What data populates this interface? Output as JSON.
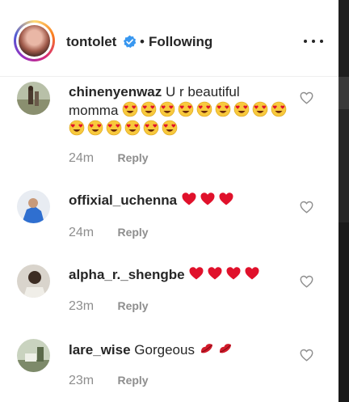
{
  "post": {
    "username": "tontolet",
    "separator": "•",
    "follow_status": "Following"
  },
  "comments": [
    {
      "username": "chinenyenwaz",
      "text": "U r beautiful momma",
      "emoji": "heart-eyes-emoji",
      "emoji_count": 15,
      "time": "24m",
      "reply": "Reply"
    },
    {
      "username": "offixial_uchenna",
      "text": "",
      "emoji": "red-heart-emoji",
      "emoji_count": 3,
      "time": "24m",
      "reply": "Reply"
    },
    {
      "username": "alpha_r._shengbe",
      "text": "",
      "emoji": "red-heart-emoji",
      "emoji_count": 4,
      "time": "23m",
      "reply": "Reply"
    },
    {
      "username": "lare_wise",
      "text": "Gorgeous",
      "emoji": "lips-emoji",
      "emoji_count": 2,
      "time": "23m",
      "reply": "Reply"
    }
  ],
  "colors": {
    "text": "#262626",
    "secondary": "#8e8e8e",
    "verified": "#3897f0",
    "heart_red": "#e0112b"
  }
}
